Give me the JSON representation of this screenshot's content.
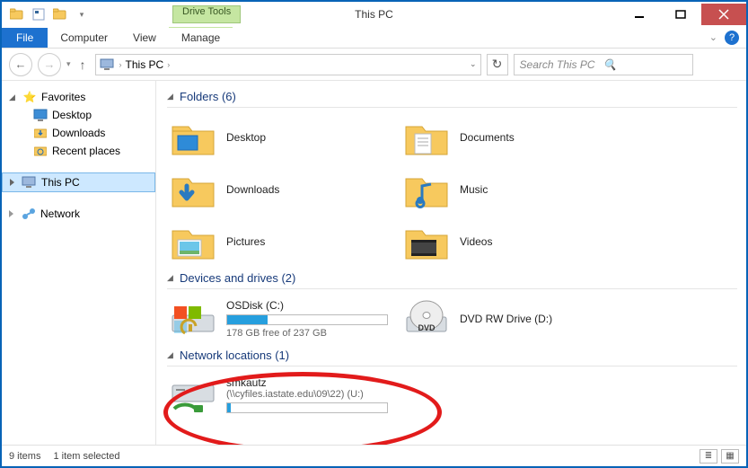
{
  "window": {
    "title": "This PC",
    "contextual_tab": "Drive Tools"
  },
  "ribbon": {
    "file": "File",
    "tabs": [
      "Computer",
      "View",
      "Manage"
    ]
  },
  "breadcrumb": {
    "root": "This PC",
    "sep": "›"
  },
  "search": {
    "placeholder": "Search This PC"
  },
  "nav": {
    "favorites": "Favorites",
    "items": [
      "Desktop",
      "Downloads",
      "Recent places"
    ],
    "thispc": "This PC",
    "network": "Network"
  },
  "groups": {
    "folders": {
      "title": "Folders (6)",
      "items": [
        "Desktop",
        "Documents",
        "Downloads",
        "Music",
        "Pictures",
        "Videos"
      ]
    },
    "drives": {
      "title": "Devices and drives (2)",
      "osdisk": {
        "label": "OSDisk (C:)",
        "sub": "178 GB free of 237 GB",
        "fill_pct": 25
      },
      "dvd": {
        "label": "DVD RW Drive (D:)"
      }
    },
    "netloc": {
      "title": "Network locations (1)",
      "item": {
        "label": "smkautz",
        "sub": "(\\\\cyfiles.iastate.edu\\09\\22) (U:)",
        "fill_pct": 2
      }
    }
  },
  "status": {
    "count": "9 items",
    "selected": "1 item selected"
  }
}
